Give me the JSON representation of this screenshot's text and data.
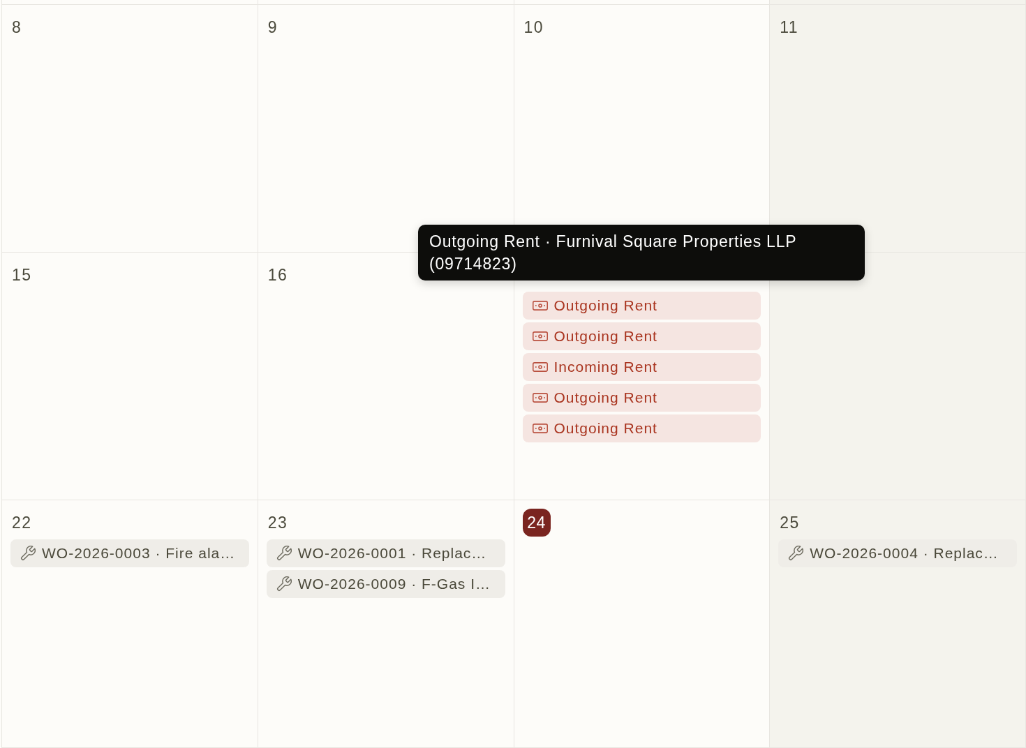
{
  "columns": [
    {
      "muted": false
    },
    {
      "muted": false
    },
    {
      "muted": false
    },
    {
      "muted": true
    }
  ],
  "weeks": [
    {
      "days": [
        {
          "date": "8",
          "today": false
        },
        {
          "date": "9",
          "today": false
        },
        {
          "date": "10",
          "today": false
        },
        {
          "date": "11",
          "today": false
        }
      ]
    },
    {
      "days": [
        {
          "date": "15",
          "today": false
        },
        {
          "date": "16",
          "today": false
        },
        {
          "events": [
            {
              "kind": "rent",
              "label": "Outgoing Rent"
            },
            {
              "kind": "rent",
              "label": "Outgoing Rent"
            },
            {
              "kind": "rent",
              "label": "Incoming Rent"
            },
            {
              "kind": "rent",
              "label": "Outgoing Rent"
            },
            {
              "kind": "rent",
              "label": "Outgoing Rent"
            }
          ]
        }
      ]
    },
    {
      "days": [
        {
          "date": "22",
          "today": false,
          "events": [
            {
              "kind": "work_order",
              "label": "WO-2026-0003 · Fire ala…"
            }
          ]
        },
        {
          "date": "23",
          "today": false,
          "events": [
            {
              "kind": "work_order",
              "label": "WO-2026-0001 · Replac…"
            },
            {
              "kind": "work_order",
              "label": "WO-2026-0009 · F-Gas I…"
            }
          ]
        },
        {
          "date": "24",
          "today": true
        },
        {
          "date": "25",
          "today": false,
          "events": [
            {
              "kind": "work_order",
              "label": "WO-2026-0004 · Replac…"
            }
          ]
        }
      ]
    }
  ],
  "tooltip": {
    "text": "Outgoing Rent · Furnival Square Properties LLP (09714823)"
  }
}
